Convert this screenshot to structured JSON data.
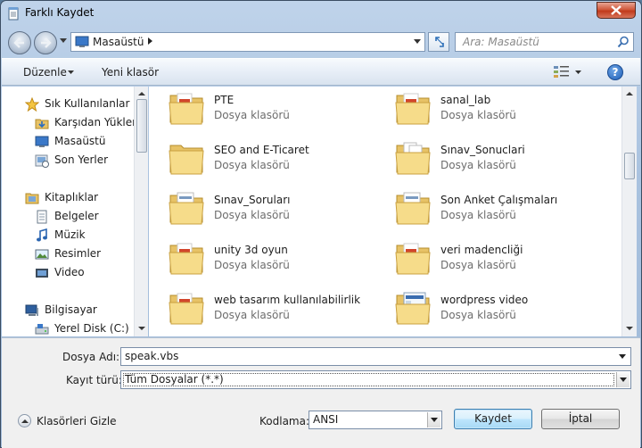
{
  "window": {
    "title": "Farklı Kaydet"
  },
  "address_bar": {
    "location": "Masaüstü"
  },
  "search": {
    "placeholder": "Ara: Masaüstü"
  },
  "toolbar": {
    "organize_label": "Düzenle",
    "new_folder_label": "Yeni klasör",
    "help_label": "?"
  },
  "nav_pane": {
    "items": [
      {
        "label": "Sık Kullanılanlar",
        "icon": "star-icon"
      },
      {
        "label": "Karşıdan Yüklem",
        "icon": "downloads-folder-icon"
      },
      {
        "label": "Masaüstü",
        "icon": "desktop-icon"
      },
      {
        "label": "Son Yerler",
        "icon": "recent-places-icon"
      },
      {
        "label": "Kitaplıklar",
        "icon": "libraries-icon"
      },
      {
        "label": "Belgeler",
        "icon": "documents-icon"
      },
      {
        "label": "Müzik",
        "icon": "music-icon"
      },
      {
        "label": "Resimler",
        "icon": "pictures-icon"
      },
      {
        "label": "Video",
        "icon": "video-icon"
      },
      {
        "label": "Bilgisayar",
        "icon": "computer-icon"
      },
      {
        "label": "Yerel Disk (C:)",
        "icon": "disk-icon"
      }
    ]
  },
  "files": [
    {
      "name": "PTE",
      "type": "Dosya klasörü"
    },
    {
      "name": "sanal_lab",
      "type": "Dosya klasörü"
    },
    {
      "name": "SEO and E-Ticaret",
      "type": "Dosya klasörü"
    },
    {
      "name": "Sınav_Sonuclari",
      "type": "Dosya klasörü"
    },
    {
      "name": "Sınav_Soruları",
      "type": "Dosya klasörü"
    },
    {
      "name": "Son Anket Çalışmaları",
      "type": "Dosya klasörü"
    },
    {
      "name": "unity 3d oyun",
      "type": "Dosya klasörü"
    },
    {
      "name": "veri madencliği",
      "type": "Dosya klasörü"
    },
    {
      "name": "web tasarım kullanılabilirlik",
      "type": "Dosya klasörü"
    },
    {
      "name": "wordpress video",
      "type": "Dosya klasörü"
    }
  ],
  "form": {
    "filename_label": "Dosya Adı:",
    "filename_value": "speak.vbs",
    "filetype_label": "Kayıt türü:",
    "filetype_value": "Tüm Dosyalar  (*.*)",
    "hide_folders_label": "Klasörleri Gizle",
    "encoding_label": "Kodlama:",
    "encoding_value": "ANSI",
    "save_label": "Kaydet",
    "cancel_label": "İptal"
  },
  "colors": {
    "accent": "#3c7fb1",
    "close": "#c03a1c",
    "folder": "#f2d37a"
  }
}
